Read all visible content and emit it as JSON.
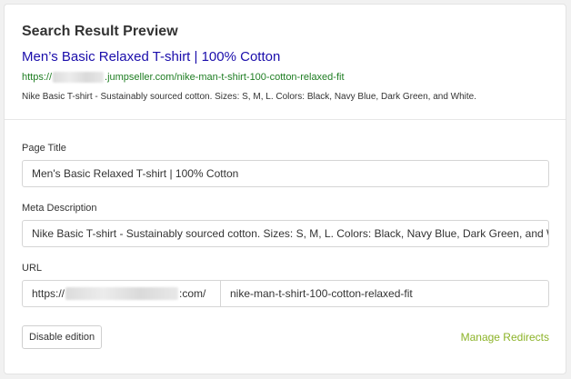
{
  "preview": {
    "heading": "Search Result Preview",
    "title": "Men’s Basic Relaxed T-shirt | 100% Cotton",
    "url_scheme": "https://",
    "url_rest": ".jumpseller.com/nike-man-t-shirt-100-cotton-relaxed-fit",
    "description": "Nike Basic T-shirt - Sustainably sourced cotton. Sizes: S, M, L. Colors: Black, Navy Blue, Dark Green, and White."
  },
  "form": {
    "page_title_label": "Page Title",
    "page_title_value": "Men's Basic Relaxed T-shirt | 100% Cotton",
    "meta_description_label": "Meta Description",
    "meta_description_value": "Nike Basic T-shirt - Sustainably sourced cotton. Sizes: S, M, L. Colors: Black, Navy Blue, Dark Green, and White.",
    "url_label": "URL",
    "url_prefix_scheme": "https://",
    "url_prefix_suffix": ":com/",
    "url_slug": "nike-man-t-shirt-100-cotton-relaxed-fit"
  },
  "actions": {
    "disable_label": "Disable edition",
    "manage_redirects_label": "Manage Redirects"
  },
  "colors": {
    "title_link": "#1a0dab",
    "url_green": "#1e7d22",
    "accent_link": "#8cb328"
  }
}
